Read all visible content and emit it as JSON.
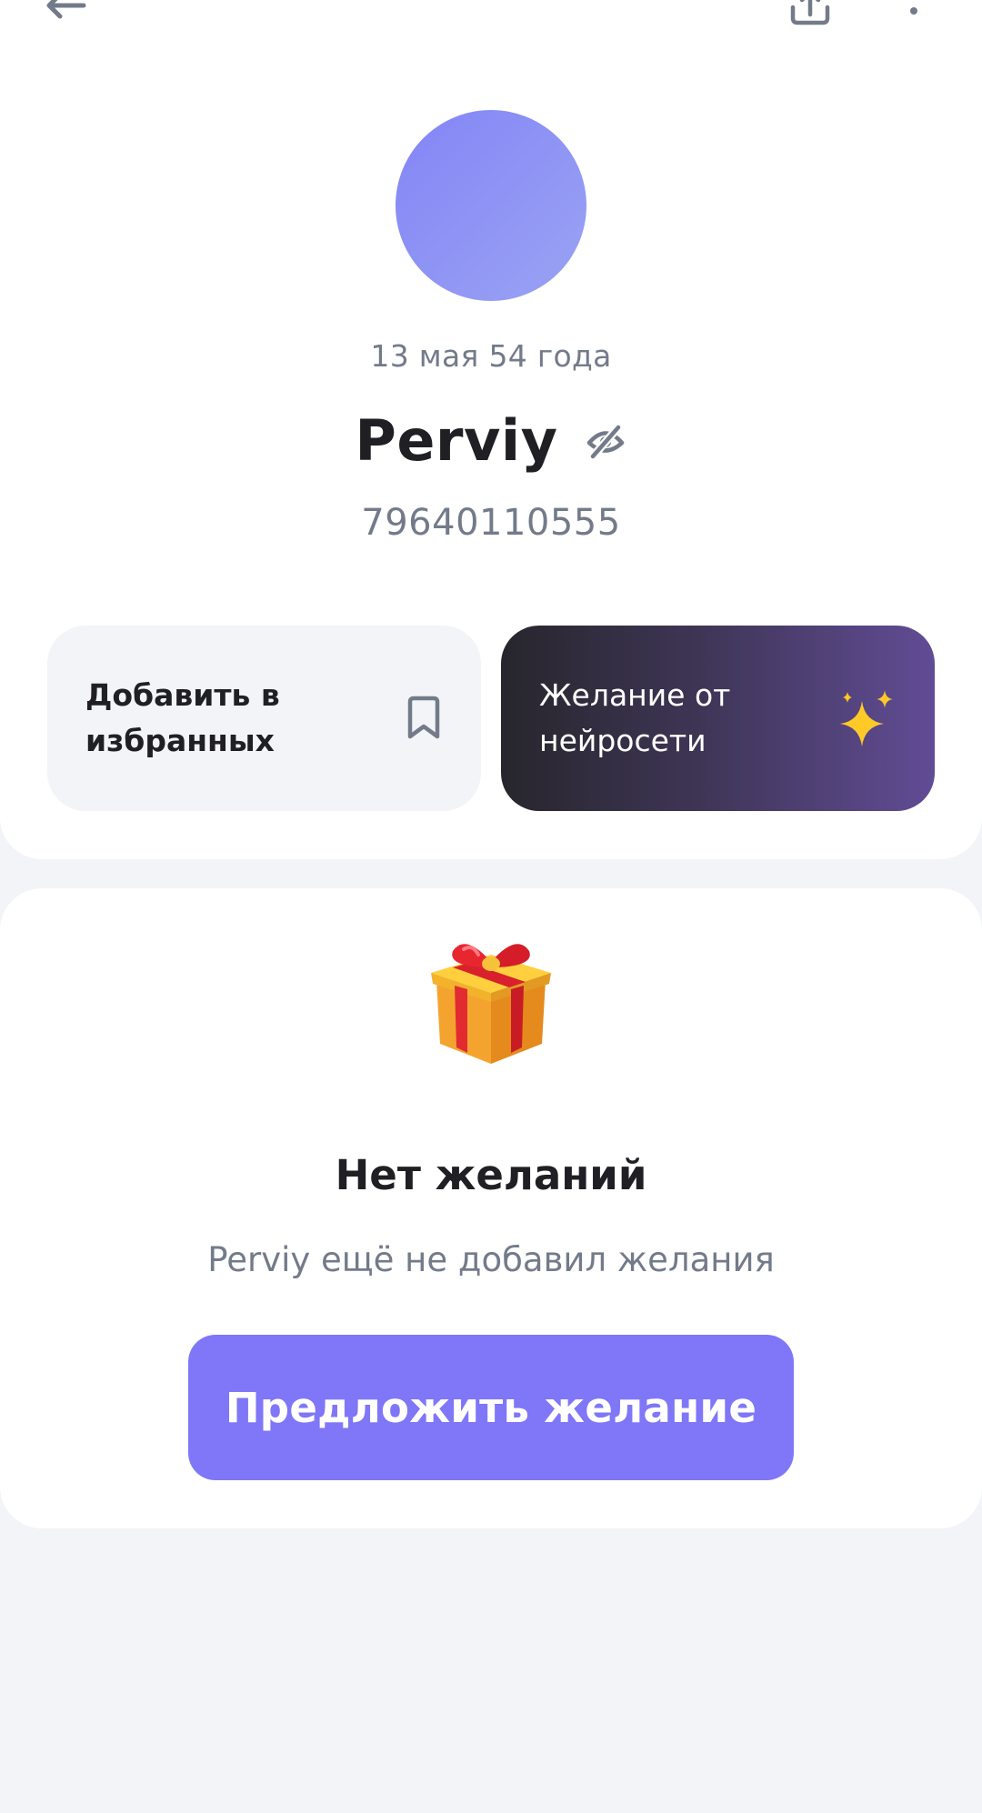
{
  "profile": {
    "birthday": "13 мая 54 года",
    "name": "Perviy",
    "phone": "79640110555"
  },
  "actions": {
    "favorites_label": "Добавить в\nизбранных",
    "ai_wish_label": "Желание от\nнейросети"
  },
  "wishes": {
    "empty_title": "Нет желаний",
    "empty_subtitle": "Perviy ещё не добавил желания",
    "suggest_button": "Предложить желание"
  },
  "icons": {
    "back": "arrow-left-icon",
    "share": "share-icon",
    "more": "more-vertical-icon",
    "hidden": "eye-off-icon",
    "bookmark": "bookmark-icon",
    "sparkles": "sparkles-icon",
    "gift": "gift-icon"
  },
  "colors": {
    "accent": "#7f77f7",
    "avatar": "#8b8ff5",
    "muted_text": "#737b8a",
    "background": "#f3f4f8"
  }
}
